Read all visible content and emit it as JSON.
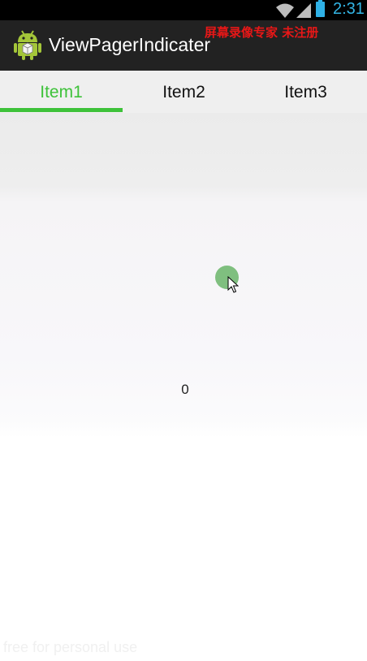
{
  "status_bar": {
    "time": "2:31",
    "icons": [
      "wifi-icon",
      "signal-icon",
      "battery-icon"
    ]
  },
  "action_bar": {
    "title": "ViewPagerIndicater",
    "icon": "android-robot-icon",
    "watermark": "屏幕录像专家 未注册"
  },
  "tabs": [
    {
      "label": "Item1",
      "selected": true
    },
    {
      "label": "Item2",
      "selected": false
    },
    {
      "label": "Item3",
      "selected": false
    }
  ],
  "page": {
    "content": "0"
  },
  "watermark_bottom": "free for personal use",
  "colors": {
    "accent": "#3ec23a",
    "action_bar": "#222222",
    "status_text": "#33b5e5",
    "watermark": "#e81717"
  }
}
